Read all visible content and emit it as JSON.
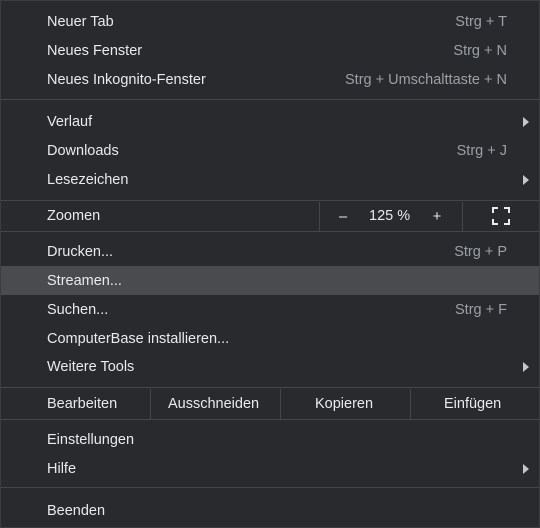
{
  "menu": {
    "new_tab": {
      "label": "Neuer Tab",
      "shortcut": "Strg + T"
    },
    "new_window": {
      "label": "Neues Fenster",
      "shortcut": "Strg + N"
    },
    "new_incognito": {
      "label": "Neues Inkognito-Fenster",
      "shortcut": "Strg + Umschalttaste + N"
    },
    "history": {
      "label": "Verlauf"
    },
    "downloads": {
      "label": "Downloads",
      "shortcut": "Strg + J"
    },
    "bookmarks": {
      "label": "Lesezeichen"
    },
    "zoom": {
      "label": "Zoomen",
      "minus": "–",
      "value": "125 %",
      "plus": "+"
    },
    "print": {
      "label": "Drucken...",
      "shortcut": "Strg + P"
    },
    "cast": {
      "label": "Streamen..."
    },
    "find": {
      "label": "Suchen...",
      "shortcut": "Strg + F"
    },
    "install": {
      "label": "ComputerBase installieren..."
    },
    "more_tools": {
      "label": "Weitere Tools"
    },
    "edit": {
      "label": "Bearbeiten",
      "cut": "Ausschneiden",
      "copy": "Kopieren",
      "paste": "Einfügen"
    },
    "settings": {
      "label": "Einstellungen"
    },
    "help": {
      "label": "Hilfe"
    },
    "exit": {
      "label": "Beenden"
    }
  }
}
